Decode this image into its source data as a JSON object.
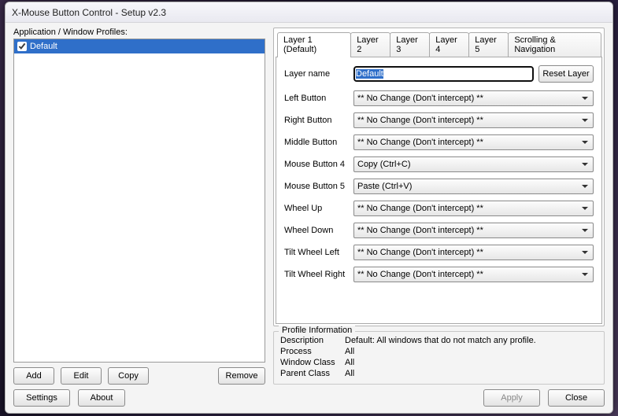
{
  "window": {
    "title": "X-Mouse Button Control - Setup v2.3"
  },
  "left": {
    "section_label": "Application / Window Profiles:",
    "profiles": [
      {
        "label": "Default",
        "checked": true,
        "selected": true
      }
    ],
    "buttons": {
      "add": "Add",
      "edit": "Edit",
      "copy": "Copy",
      "remove": "Remove"
    }
  },
  "tabs": [
    {
      "label": "Layer 1 (Default)",
      "active": true
    },
    {
      "label": "Layer 2"
    },
    {
      "label": "Layer 3"
    },
    {
      "label": "Layer 4"
    },
    {
      "label": "Layer 5"
    },
    {
      "label": "Scrolling & Navigation"
    }
  ],
  "layer": {
    "name_label": "Layer name",
    "name_value": "Default",
    "reset_label": "Reset Layer",
    "rows": [
      {
        "label": "Left Button",
        "value": "** No Change (Don't intercept) **"
      },
      {
        "label": "Right Button",
        "value": "** No Change (Don't intercept) **"
      },
      {
        "label": "Middle Button",
        "value": "** No Change (Don't intercept) **"
      },
      {
        "label": "Mouse Button 4",
        "value": "Copy (Ctrl+C)"
      },
      {
        "label": "Mouse Button 5",
        "value": "Paste (Ctrl+V)"
      },
      {
        "label": "Wheel Up",
        "value": "** No Change (Don't intercept) **"
      },
      {
        "label": "Wheel Down",
        "value": "** No Change (Don't intercept) **"
      },
      {
        "label": "Tilt Wheel Left",
        "value": "** No Change (Don't intercept) **"
      },
      {
        "label": "Tilt Wheel Right",
        "value": "** No Change (Don't intercept) **"
      }
    ]
  },
  "profile_info": {
    "legend": "Profile Information",
    "rows": [
      {
        "label": "Description",
        "value": "Default: All windows that do not match any profile."
      },
      {
        "label": "Process",
        "value": "All"
      },
      {
        "label": "Window Class",
        "value": "All"
      },
      {
        "label": "Parent Class",
        "value": "All"
      }
    ]
  },
  "footer": {
    "settings": "Settings",
    "about": "About",
    "apply": "Apply",
    "close": "Close"
  }
}
